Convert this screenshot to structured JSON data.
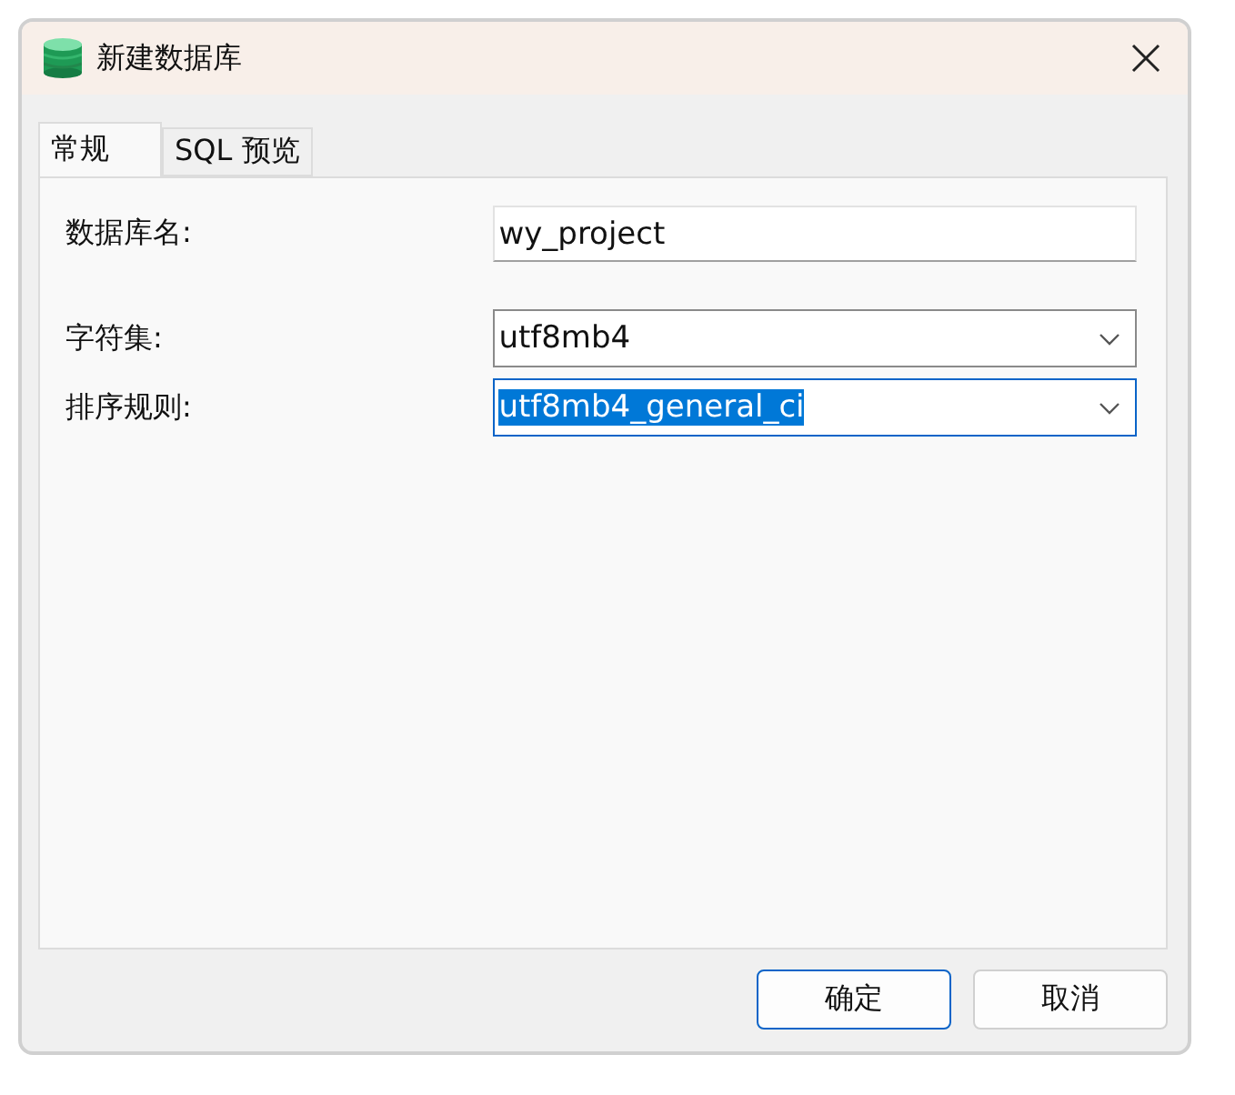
{
  "window": {
    "title": "新建数据库"
  },
  "tabs": [
    {
      "label": "常规",
      "selected": true
    },
    {
      "label": "SQL 预览",
      "selected": false
    }
  ],
  "fields": [
    {
      "kind": "text",
      "label": "数据库名:",
      "value": "wy_project",
      "highlighted": false
    },
    {
      "kind": "select",
      "label": "字符集:",
      "value": "utf8mb4",
      "highlighted": false
    },
    {
      "kind": "select",
      "label": "排序规则:",
      "value": "utf8mb4_general_ci",
      "highlighted": true
    }
  ],
  "buttons": [
    {
      "label": "确定",
      "default": true
    },
    {
      "label": "取消",
      "default": false
    }
  ]
}
